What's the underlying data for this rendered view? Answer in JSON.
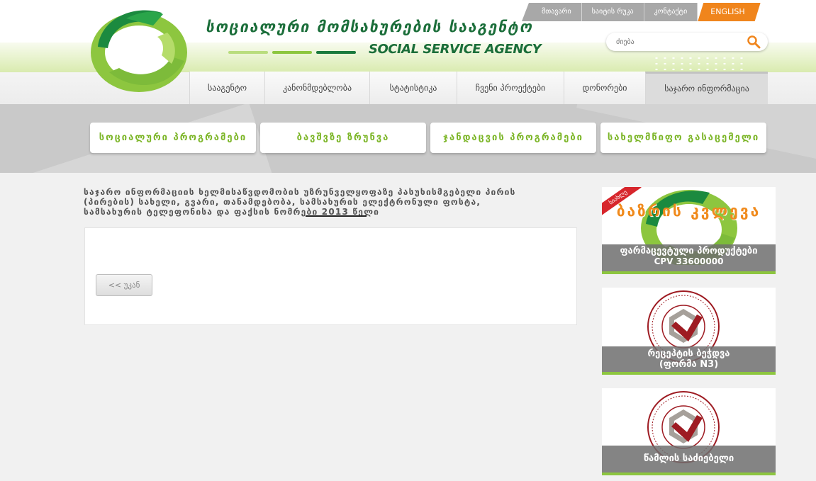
{
  "brand": {
    "name_ka": "სოციალური მომსახურების სააგენტო",
    "name_en": "SOCIAL SERVICE AGENCY",
    "colors": {
      "green_dark": "#1b6e3a",
      "green_light": "#8dc63f",
      "orange": "#f0851c"
    }
  },
  "toplinks": [
    {
      "label": "მთავარი"
    },
    {
      "label": "საიტის რუკა"
    },
    {
      "label": "კონტაქტი"
    }
  ],
  "language": {
    "label": "ENGLISH"
  },
  "search": {
    "placeholder": "ძიება",
    "icon": "search-icon"
  },
  "mainnav": [
    {
      "label": "სააგენტო"
    },
    {
      "label": "კანონმდებლობა"
    },
    {
      "label": "სტატისტიკა"
    },
    {
      "label": "ჩვენი პროექტები"
    },
    {
      "label": "დონორები"
    },
    {
      "label": "საჯარო ინფორმაცია",
      "active": true
    }
  ],
  "programs": [
    {
      "label": "სოციალური პროგრამები"
    },
    {
      "label": "ბავშვზე ზრუნვა"
    },
    {
      "label": "ჯანდაცვის პროგრამები"
    },
    {
      "label": "სახელმწიფო გასაცემელი"
    }
  ],
  "content": {
    "heading": "საჯარო ინფორმაციის ხელმისაწვდომობის უზრუნველყოფაზე პასუხისმგებელი პირის (პირების) სახელი, გვარი, თანამდებობა, სამსახურის ელექტრონული ფოსტა, სამსახურის ტელეფონისა და ფაქსის ნომრები",
    "year": "2013 წელი",
    "back_label": "<< უკან"
  },
  "banners": [
    {
      "ribbon": "სიახლე",
      "title": "ბაზრის კვლევა",
      "caption": "ფარმაცევტული პროდუქტები",
      "subcaption": "CPV 33600000"
    },
    {
      "caption_line1": "რეცეპტის ბეჭდვა",
      "caption_line2": "(ფორმა N3)"
    },
    {
      "caption": "წამლის საძიებელი"
    }
  ]
}
